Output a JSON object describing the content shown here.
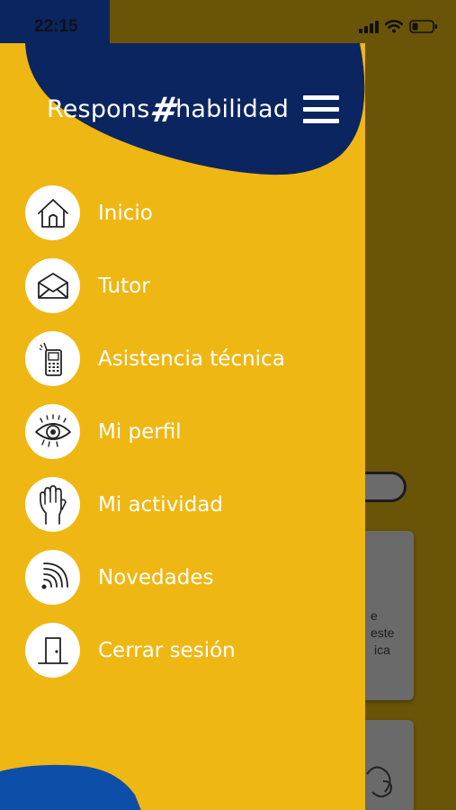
{
  "status_bar": {
    "time": "22:15"
  },
  "drawer": {
    "logo": {
      "part1": "Respons",
      "hash": "#",
      "part2": "habilidad"
    },
    "menu": [
      {
        "label": "Inicio",
        "icon": "home-icon"
      },
      {
        "label": "Tutor",
        "icon": "envelope-icon"
      },
      {
        "label": "Asistencia técnica",
        "icon": "phone-icon"
      },
      {
        "label": "Mi perfil",
        "icon": "eye-icon"
      },
      {
        "label": "Mi actividad",
        "icon": "hand-icon"
      },
      {
        "label": "Novedades",
        "icon": "wifi-signal-icon"
      },
      {
        "label": "Cerrar sesión",
        "icon": "door-icon"
      }
    ]
  },
  "background": {
    "card_text_line1": "e este",
    "card_text_line2": "ica"
  },
  "colors": {
    "drawer": "#efb714",
    "navy": "#0b2561",
    "blue_bottom": "#0d4fa8",
    "overlay": "#6a5408"
  }
}
